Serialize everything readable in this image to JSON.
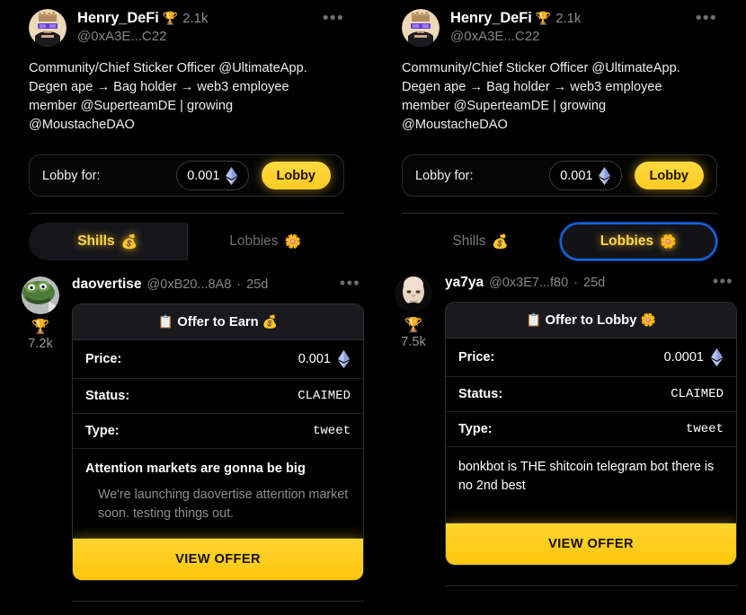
{
  "panels": [
    {
      "id": "shills-panel",
      "profile": {
        "display_name": "Henry_DeFi",
        "trophy_icon": "trophy-emoji",
        "trophy_glyph": "🏆",
        "rep_count": "2.1k",
        "handle": "@0xA3E...C22",
        "kebab": "•••",
        "bio": "Community/Chief Sticker Officer @UltimateApp. Degen ape → Bag holder → web3 employee member @SuperteamDE | growing @MoustacheDAO"
      },
      "lobby_bar": {
        "label": "Lobby for:",
        "amount": "0.001",
        "currency_icon": "ethereum-diamond-icon",
        "button_label": "Lobby"
      },
      "tabs": [
        {
          "label": "Shills",
          "emoji": "💰",
          "emoji_name": "money-bag-emoji",
          "state": "active-fill"
        },
        {
          "label": "Lobbies",
          "emoji": "🌼",
          "emoji_name": "butterfly-emoji",
          "state": "inactive"
        }
      ],
      "post": {
        "avatar_icon": "pepe-avatar",
        "score_trophy": "🏆",
        "score_value": "7.2k",
        "author": "daovertise",
        "handle": "@0xB20...8A8",
        "separator": "·",
        "age": "25d",
        "kebab": "•••",
        "card": {
          "header_emoji_left": "📋",
          "header_emoji_left_name": "clipboard-emoji",
          "header_title": "Offer to Earn",
          "header_emoji_right": "💰",
          "header_emoji_right_name": "money-bag-emoji",
          "rows": [
            {
              "key": "Price:",
              "value": "0.001",
              "has_eth_icon": true
            },
            {
              "key": "Status:",
              "value": "CLAIMED",
              "has_eth_icon": false
            },
            {
              "key": "Type:",
              "value": "tweet",
              "has_eth_icon": false
            }
          ],
          "body_title": "Attention markets are gonna be big",
          "body_sub": "We're launching daovertise attention market soon. testing things out.",
          "cta_label": "VIEW OFFER"
        }
      }
    },
    {
      "id": "lobbies-panel",
      "profile": {
        "display_name": "Henry_DeFi",
        "trophy_icon": "trophy-emoji",
        "trophy_glyph": "🏆",
        "rep_count": "2.1k",
        "handle": "@0xA3E...C22",
        "kebab": "•••",
        "bio": "Community/Chief Sticker Officer @UltimateApp. Degen ape → Bag holder → web3 employee member @SuperteamDE | growing @MoustacheDAO"
      },
      "lobby_bar": {
        "label": "Lobby for:",
        "amount": "0.001",
        "currency_icon": "ethereum-diamond-icon",
        "button_label": "Lobby"
      },
      "tabs": [
        {
          "label": "Shills",
          "emoji": "💰",
          "emoji_name": "money-bag-emoji",
          "state": "inactive"
        },
        {
          "label": "Lobbies",
          "emoji": "🌼",
          "emoji_name": "butterfly-emoji",
          "state": "active-ring"
        }
      ],
      "post": {
        "avatar_icon": "face-photo-avatar",
        "score_trophy": "🏆",
        "score_value": "7.5k",
        "author": "ya7ya",
        "handle": "@0x3E7...f80",
        "separator": "·",
        "age": "25d",
        "kebab": "•••",
        "card": {
          "header_emoji_left": "📋",
          "header_emoji_left_name": "clipboard-emoji",
          "header_title": "Offer to Lobby",
          "header_emoji_right": "🌼",
          "header_emoji_right_name": "butterfly-emoji",
          "rows": [
            {
              "key": "Price:",
              "value": "0.0001",
              "has_eth_icon": true
            },
            {
              "key": "Status:",
              "value": "CLAIMED",
              "has_eth_icon": false
            },
            {
              "key": "Type:",
              "value": "tweet",
              "has_eth_icon": false
            }
          ],
          "body_title": "bonkbot is THE shitcoin telegram bot there is no 2nd best",
          "body_sub": "",
          "cta_label": "VIEW OFFER"
        }
      }
    }
  ],
  "colors": {
    "background": "#000000",
    "accent_yellow": "#ffce23",
    "focus_blue": "#1565e0",
    "muted_text": "#87878b",
    "divider": "#2a2a2d",
    "card_header_bg": "#1a1a1e"
  }
}
